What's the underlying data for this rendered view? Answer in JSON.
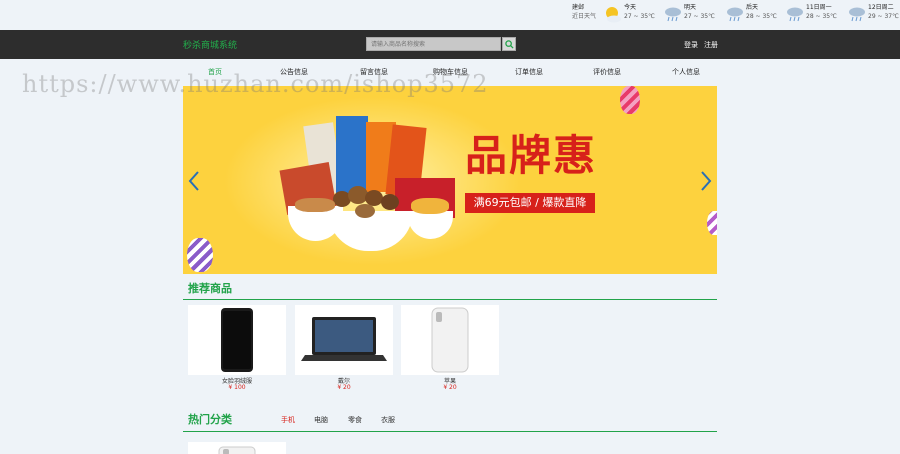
{
  "weather": {
    "city": "建邺",
    "subtitle": "近日天气",
    "days": [
      {
        "name": "今天",
        "temp": "27 ~ 35℃",
        "icon": "sun-cloud-icon"
      },
      {
        "name": "明天",
        "temp": "27 ~ 35℃",
        "icon": "rain-icon"
      },
      {
        "name": "后天",
        "temp": "28 ~ 35℃",
        "icon": "rain-icon"
      },
      {
        "name": "11日周一",
        "temp": "28 ~ 35℃",
        "icon": "rain-icon"
      },
      {
        "name": "12日周二",
        "temp": "29 ~ 37℃",
        "icon": "rain-icon"
      }
    ]
  },
  "header": {
    "brand": "秒杀商城系统",
    "search_placeholder": "请输入商品名称搜索",
    "login": "登录",
    "register": "注册"
  },
  "nav": {
    "items": [
      "首页",
      "公告信息",
      "留言信息",
      "购物车信息",
      "订单信息",
      "评价信息",
      "个人信息"
    ]
  },
  "banner": {
    "slogan": "品牌惠",
    "promo": "满69元包邮 / 爆款直降"
  },
  "recommended": {
    "title": "推荐商品",
    "products": [
      {
        "name": "女脸羽绒服",
        "price": "¥ 100"
      },
      {
        "name": "戴尔",
        "price": "¥ 20"
      },
      {
        "name": "苹果",
        "price": "¥ 20"
      }
    ]
  },
  "hot": {
    "title": "热门分类",
    "tabs": [
      "手机",
      "电脑",
      "零食",
      "衣服"
    ]
  },
  "watermark": "https://www.huzhan.com/ishop3572",
  "colors": {
    "accent": "#22a34a",
    "price": "#d7211a",
    "topbar": "#2d2d2d",
    "banner": "#fdd23e"
  }
}
